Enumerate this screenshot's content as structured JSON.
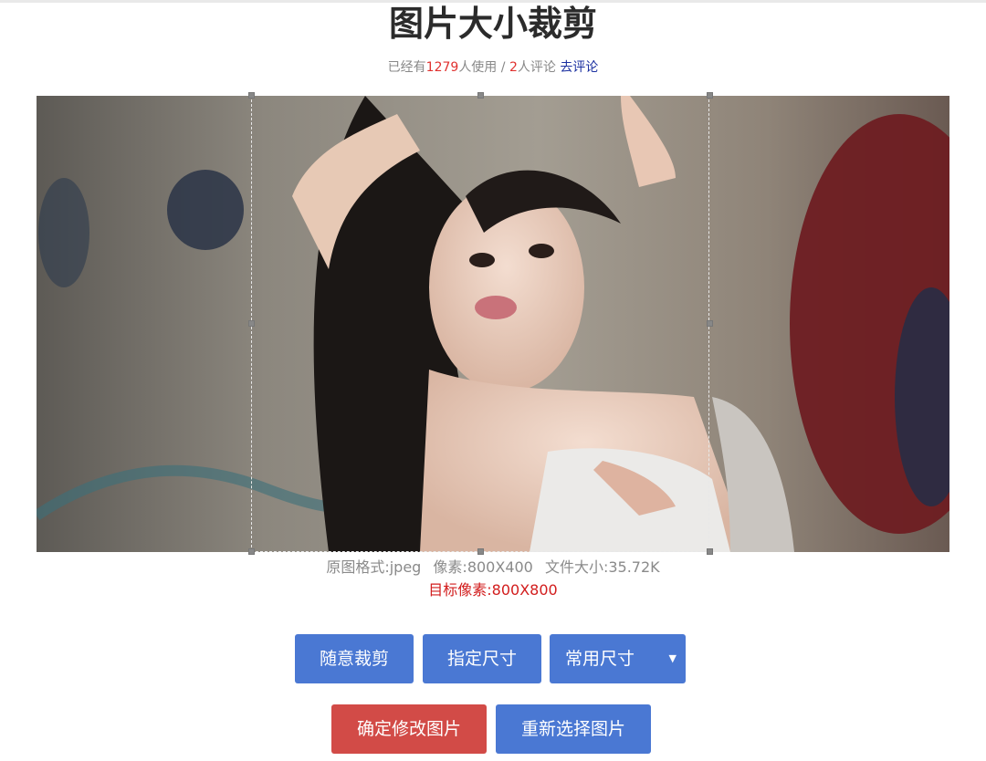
{
  "page": {
    "title": "图片大小裁剪",
    "stats": {
      "prefix": "已经有",
      "users": "1279",
      "users_suffix": "人使用 /",
      "comments": "2",
      "comments_suffix": "人评论",
      "comment_link": "去评论"
    }
  },
  "image_info": {
    "format": "原图格式:jpeg",
    "pixels": "像素:800X400",
    "filesize": "文件大小:35.72K",
    "target": "目标像素:800X800"
  },
  "buttons": {
    "free_crop": "随意裁剪",
    "fixed_size": "指定尺寸",
    "common_size": "常用尺寸",
    "common_size_caret": "▼",
    "confirm": "确定修改图片",
    "reselect": "重新选择图片"
  },
  "colors": {
    "primary_blue": "#4a78d3",
    "danger_red": "#d24b47",
    "highlight_red": "#d21d1d"
  }
}
